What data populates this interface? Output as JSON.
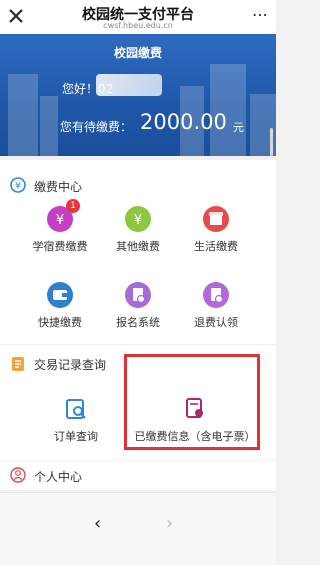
{
  "titlebar": {
    "title": "校园统一支付平台",
    "url": "cwsf.hbeu.edu.cn",
    "more_icon": "more-dots-icon",
    "close_icon": "close-icon"
  },
  "banner": {
    "title": "校园缴费",
    "greeting": "您好！02",
    "due_label": "您有待缴费：",
    "due_amount": "2000.00",
    "due_unit": "元"
  },
  "payment_center": {
    "title": "缴费中心",
    "items": [
      {
        "label": "学宿费缴费",
        "icon": "tuition-icon",
        "color": "#c53ec8",
        "badge": "1"
      },
      {
        "label": "其他缴费",
        "icon": "other-payment-icon",
        "color": "#8dc63f"
      },
      {
        "label": "生活缴费",
        "icon": "life-payment-icon",
        "color": "#e54b4b"
      },
      {
        "label": "快捷缴费",
        "icon": "quick-payment-icon",
        "color": "#2f7fcf"
      },
      {
        "label": "报名系统",
        "icon": "registration-icon",
        "color": "#a56bd6"
      },
      {
        "label": "退费认领",
        "icon": "refund-icon",
        "color": "#b06ad9"
      }
    ]
  },
  "records": {
    "title": "交易记录查询",
    "items": [
      {
        "label": "订单查询",
        "icon": "order-search-icon",
        "color": "#2f86d6"
      },
      {
        "label": "已缴费信息（含电子票）",
        "icon": "paid-receipt-icon",
        "color": "#a8296e"
      }
    ]
  },
  "personal": {
    "title": "个人中心"
  },
  "nav": {
    "back": "‹",
    "forward": "›"
  }
}
